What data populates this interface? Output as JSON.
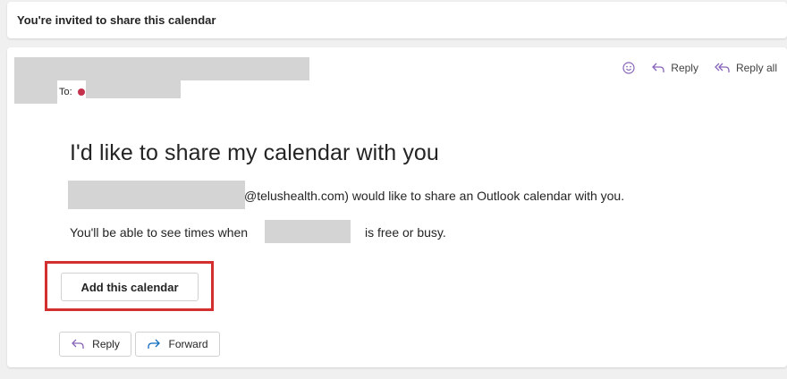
{
  "subject": "You're invited to share this calendar",
  "header": {
    "to_label": "To:",
    "actions": {
      "emoji_icon": "smiley-icon",
      "reply_label": "Reply",
      "reply_all_label": "Reply all"
    }
  },
  "message": {
    "headline": "I'd like to share my calendar with you",
    "line1_suffix": "@telushealth.com) would like to share an Outlook calendar with you.",
    "line2_prefix": "You'll be able to see times when",
    "line2_suffix": "is free or busy.",
    "add_button_label": "Add this calendar"
  },
  "footer": {
    "reply_label": "Reply",
    "forward_label": "Forward"
  },
  "colors": {
    "accent_purple": "#8764b8",
    "accent_blue": "#0f6cbd",
    "highlight_red": "#d32f2f",
    "presence_busy": "#c4314b"
  }
}
